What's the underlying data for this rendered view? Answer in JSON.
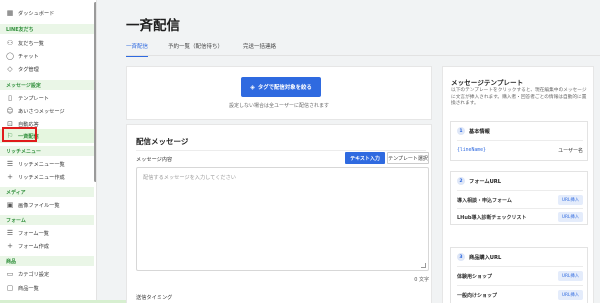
{
  "sidebar": {
    "top_item": "ダッシュボード",
    "sections": [
      {
        "label": "LINE友だち",
        "items": [
          {
            "label": "友だち一覧",
            "icon": "people-icon"
          },
          {
            "label": "チャット",
            "icon": "chat-icon"
          },
          {
            "label": "タグ管理",
            "icon": "tag-icon"
          }
        ]
      },
      {
        "label": "メッセージ設定",
        "items": [
          {
            "label": "テンプレート",
            "icon": "document-icon"
          },
          {
            "label": "あいさつメッセージ",
            "icon": "greeting-icon"
          },
          {
            "label": "自動応答",
            "icon": "robot-icon"
          },
          {
            "label": "一斉配信",
            "icon": "broadcast-icon"
          }
        ]
      },
      {
        "label": "リッチメニュー",
        "items": [
          {
            "label": "リッチメニュー一覧",
            "icon": "list-icon"
          },
          {
            "label": "リッチメニュー作成",
            "icon": "plus-icon"
          }
        ]
      },
      {
        "label": "メディア",
        "items": [
          {
            "label": "画像ファイル一覧",
            "icon": "image-icon"
          }
        ]
      },
      {
        "label": "フォーム",
        "items": [
          {
            "label": "フォーム一覧",
            "icon": "list-icon"
          },
          {
            "label": "フォーム作成",
            "icon": "plus-icon"
          }
        ]
      },
      {
        "label": "商品",
        "items": [
          {
            "label": "カテゴリ設定",
            "icon": "folder-icon"
          },
          {
            "label": "商品一覧",
            "icon": "box-icon"
          }
        ]
      }
    ]
  },
  "main": {
    "title": "一斉配信",
    "tabs": [
      "一斉配信",
      "予約一覧（配信待ち）",
      "完送一括連絡"
    ],
    "tag_button": "タグで配信対象を絞る",
    "tag_note": "設定しない場合は全ユーザーに配信されます",
    "message": {
      "title": "配信メッセージ",
      "content_label": "メッセージ内容",
      "text_input_btn": "テキスト入力",
      "template_btn": "テンプレート選択",
      "placeholder": "配信するメッセージを入力してください",
      "char_count": "0 文字",
      "send_timing": "送信タイミング"
    }
  },
  "panel": {
    "title": "メッセージテンプレート",
    "description": "以下のテンプレートをクリックすると、現在編集中のメッセージに文言が挿入されます。購入者・回答者ごとの情報は自動的に置換されます。",
    "groups": [
      {
        "num": "1",
        "title": "基本情報",
        "rows": [
          {
            "left": "{lineName}",
            "right": "ユーザー名",
            "type": "code"
          }
        ]
      },
      {
        "num": "2",
        "title": "フォームURL",
        "rows": [
          {
            "left": "導入相談・申込フォーム",
            "right": "URL挿入",
            "type": "badge"
          },
          {
            "left": "LHub導入診断チェックリスト",
            "right": "URL挿入",
            "type": "badge"
          }
        ]
      },
      {
        "num": "3",
        "title": "商品購入URL",
        "rows": [
          {
            "left": "体験用ショップ",
            "right": "URL挿入",
            "type": "badge"
          },
          {
            "left": "一般向けショップ",
            "right": "URL挿入",
            "type": "badge"
          }
        ]
      }
    ]
  },
  "colors": {
    "accent": "#2f6ae0",
    "line_green": "#2f8f3a",
    "highlight_red": "#e01b1b"
  }
}
